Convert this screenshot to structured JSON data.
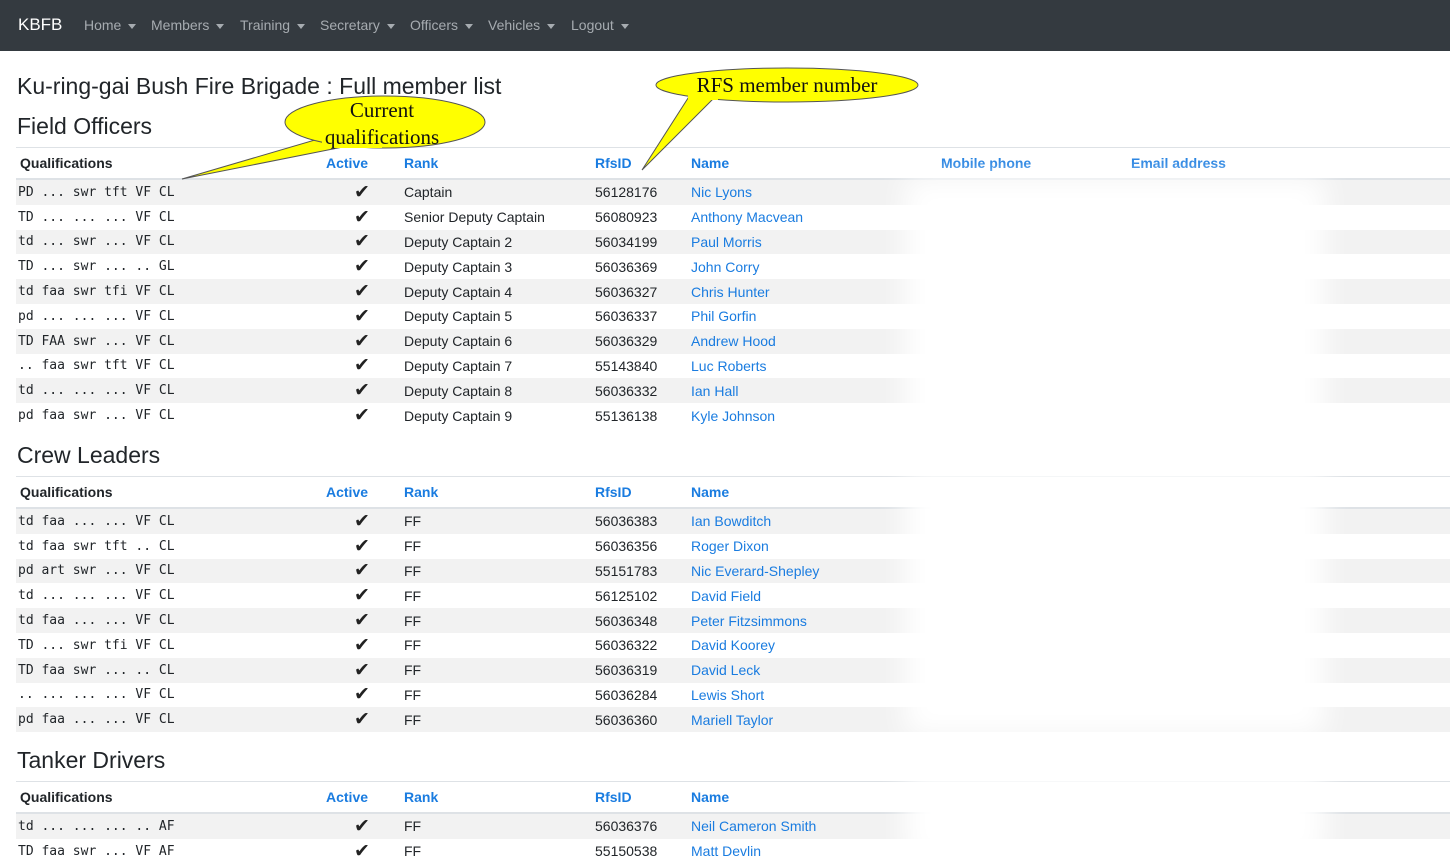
{
  "navbar": {
    "brand": "KBFB",
    "items": [
      {
        "label": "Home"
      },
      {
        "label": "Members"
      },
      {
        "label": "Training"
      },
      {
        "label": "Secretary"
      },
      {
        "label": "Officers"
      },
      {
        "label": "Vehicles"
      },
      {
        "label": "Logout"
      }
    ]
  },
  "page_title": "Ku-ring-gai Bush Fire Brigade : Full member list",
  "annotations": {
    "qualifications": "Current qualifications",
    "qual_line1": "Current",
    "qual_line2": "qualifications",
    "rfs": "RFS member number"
  },
  "columns": {
    "qualifications": "Qualifications",
    "active": "Active",
    "rank": "Rank",
    "rfsid": "RfsID",
    "name": "Name",
    "mobile": "Mobile phone",
    "email": "Email address"
  },
  "check_mark": "✔",
  "sections": {
    "field_officers": {
      "title": "Field Officers",
      "rows": [
        {
          "q": "PD ... swr tft VF CL",
          "rank": "Captain",
          "id": "56128176",
          "name": "Nic Lyons"
        },
        {
          "q": "TD ... ... ... VF CL",
          "rank": "Senior Deputy Captain",
          "id": "56080923",
          "name": "Anthony Macvean"
        },
        {
          "q": "td ... swr ... VF CL",
          "rank": "Deputy Captain 2",
          "id": "56034199",
          "name": "Paul Morris"
        },
        {
          "q": "TD ... swr ... .. GL",
          "rank": "Deputy Captain 3",
          "id": "56036369",
          "name": "John Corry"
        },
        {
          "q": "td faa swr tfi VF CL",
          "rank": "Deputy Captain 4",
          "id": "56036327",
          "name": "Chris Hunter"
        },
        {
          "q": "pd ... ... ... VF CL",
          "rank": "Deputy Captain 5",
          "id": "56036337",
          "name": "Phil Gorfin"
        },
        {
          "q": "TD FAA swr ... VF CL",
          "rank": "Deputy Captain 6",
          "id": "56036329",
          "name": "Andrew Hood"
        },
        {
          "q": ".. faa swr tft VF CL",
          "rank": "Deputy Captain 7",
          "id": "55143840",
          "name": "Luc Roberts"
        },
        {
          "q": "td ... ... ... VF CL",
          "rank": "Deputy Captain 8",
          "id": "56036332",
          "name": "Ian Hall"
        },
        {
          "q": "pd faa swr ... VF CL",
          "rank": "Deputy Captain 9",
          "id": "55136138",
          "name": "Kyle Johnson"
        }
      ]
    },
    "crew_leaders": {
      "title": "Crew Leaders",
      "rows": [
        {
          "q": "td faa ... ... VF CL",
          "rank": "FF",
          "id": "56036383",
          "name": "Ian Bowditch"
        },
        {
          "q": "td faa swr tft .. CL",
          "rank": "FF",
          "id": "56036356",
          "name": "Roger Dixon"
        },
        {
          "q": "pd art swr ... VF CL",
          "rank": "FF",
          "id": "55151783",
          "name": "Nic Everard-Shepley"
        },
        {
          "q": "td ... ... ... VF CL",
          "rank": "FF",
          "id": "56125102",
          "name": "David Field"
        },
        {
          "q": "td faa ... ... VF CL",
          "rank": "FF",
          "id": "56036348",
          "name": "Peter Fitzsimmons"
        },
        {
          "q": "TD ... swr tfi VF CL",
          "rank": "FF",
          "id": "56036322",
          "name": "David Koorey"
        },
        {
          "q": "TD faa swr ... .. CL",
          "rank": "FF",
          "id": "56036319",
          "name": "David Leck"
        },
        {
          "q": ".. ... ... ... VF CL",
          "rank": "FF",
          "id": "56036284",
          "name": "Lewis Short"
        },
        {
          "q": "pd faa ... ... VF CL",
          "rank": "FF",
          "id": "56036360",
          "name": "Mariell Taylor"
        }
      ]
    },
    "tanker_drivers": {
      "title": "Tanker Drivers",
      "rows": [
        {
          "q": "td ... ... ... .. AF",
          "rank": "FF",
          "id": "56036376",
          "name": "Neil Cameron Smith"
        },
        {
          "q": "TD faa swr ... VF AF",
          "rank": "FF",
          "id": "55150538",
          "name": "Matt Devlin"
        }
      ]
    }
  }
}
